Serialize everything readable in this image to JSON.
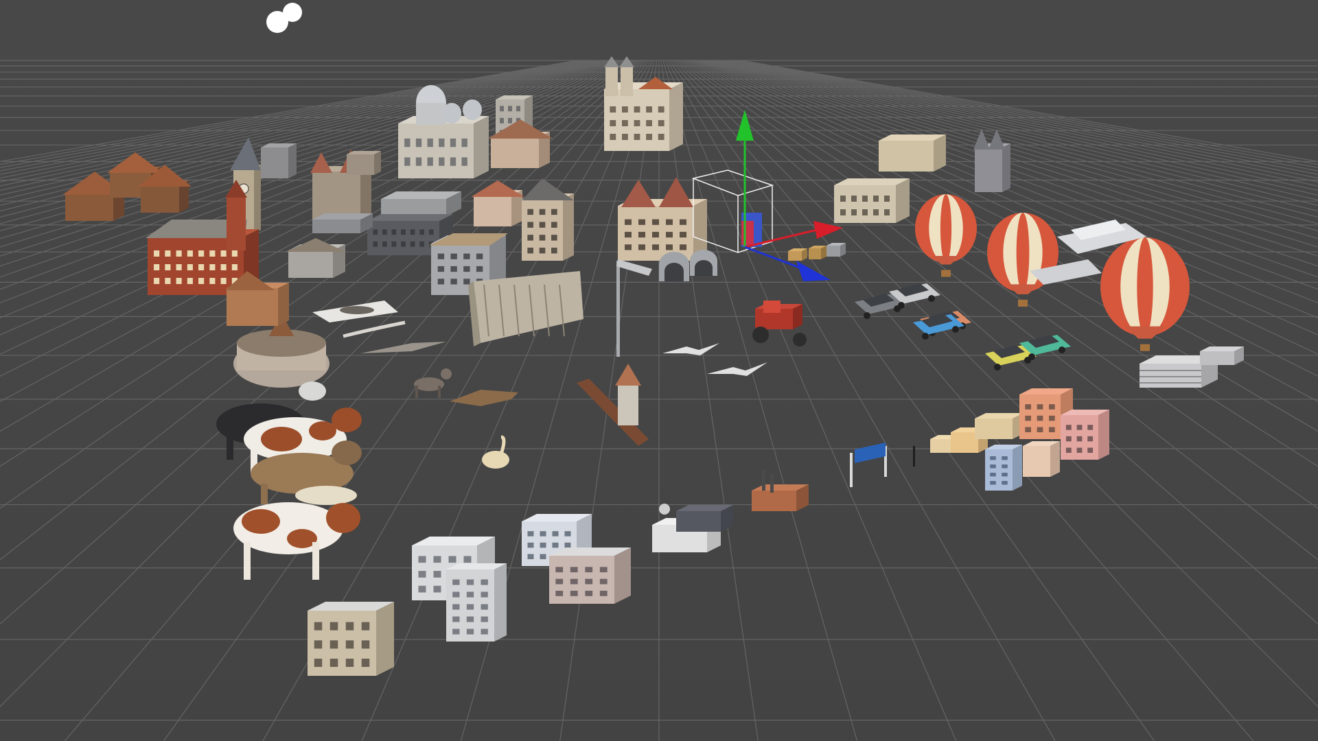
{
  "viewport": {
    "background": "#464646",
    "grid_color": "#6b6b6b",
    "selection_box_color": "#f2f2f2"
  },
  "gizmo": {
    "axes": [
      {
        "axis": "y",
        "color": "#22c22b",
        "icon": "cone-arrow-y"
      },
      {
        "axis": "x",
        "color": "#d81e2a",
        "icon": "cone-arrow-x"
      },
      {
        "axis": "z",
        "color": "#1f33d6",
        "icon": "cone-arrow-z"
      }
    ]
  },
  "scene_objects": [
    "light-icon",
    "chalets",
    "tudor-house",
    "clock-tower",
    "castle",
    "cathedral-dome",
    "cathedral-tower",
    "grossmunster",
    "chateau",
    "bell-tower",
    "red-town-hall",
    "long-hall",
    "shed",
    "manor",
    "dam",
    "villa",
    "street-lamp",
    "tunnel",
    "church",
    "round-castle",
    "stork",
    "goat",
    "dog",
    "crocodile",
    "cow-black",
    "cow-red",
    "cow-brown",
    "sheep",
    "cow-spotted",
    "swan",
    "log",
    "water-tower",
    "gull",
    "gull-2",
    "tractor",
    "cars",
    "hot-air-balloons",
    "ferry",
    "parking-garage",
    "colorful-houses",
    "road-sign",
    "small-factory",
    "station",
    "apartment-block",
    "office-buildings",
    "house-small"
  ]
}
